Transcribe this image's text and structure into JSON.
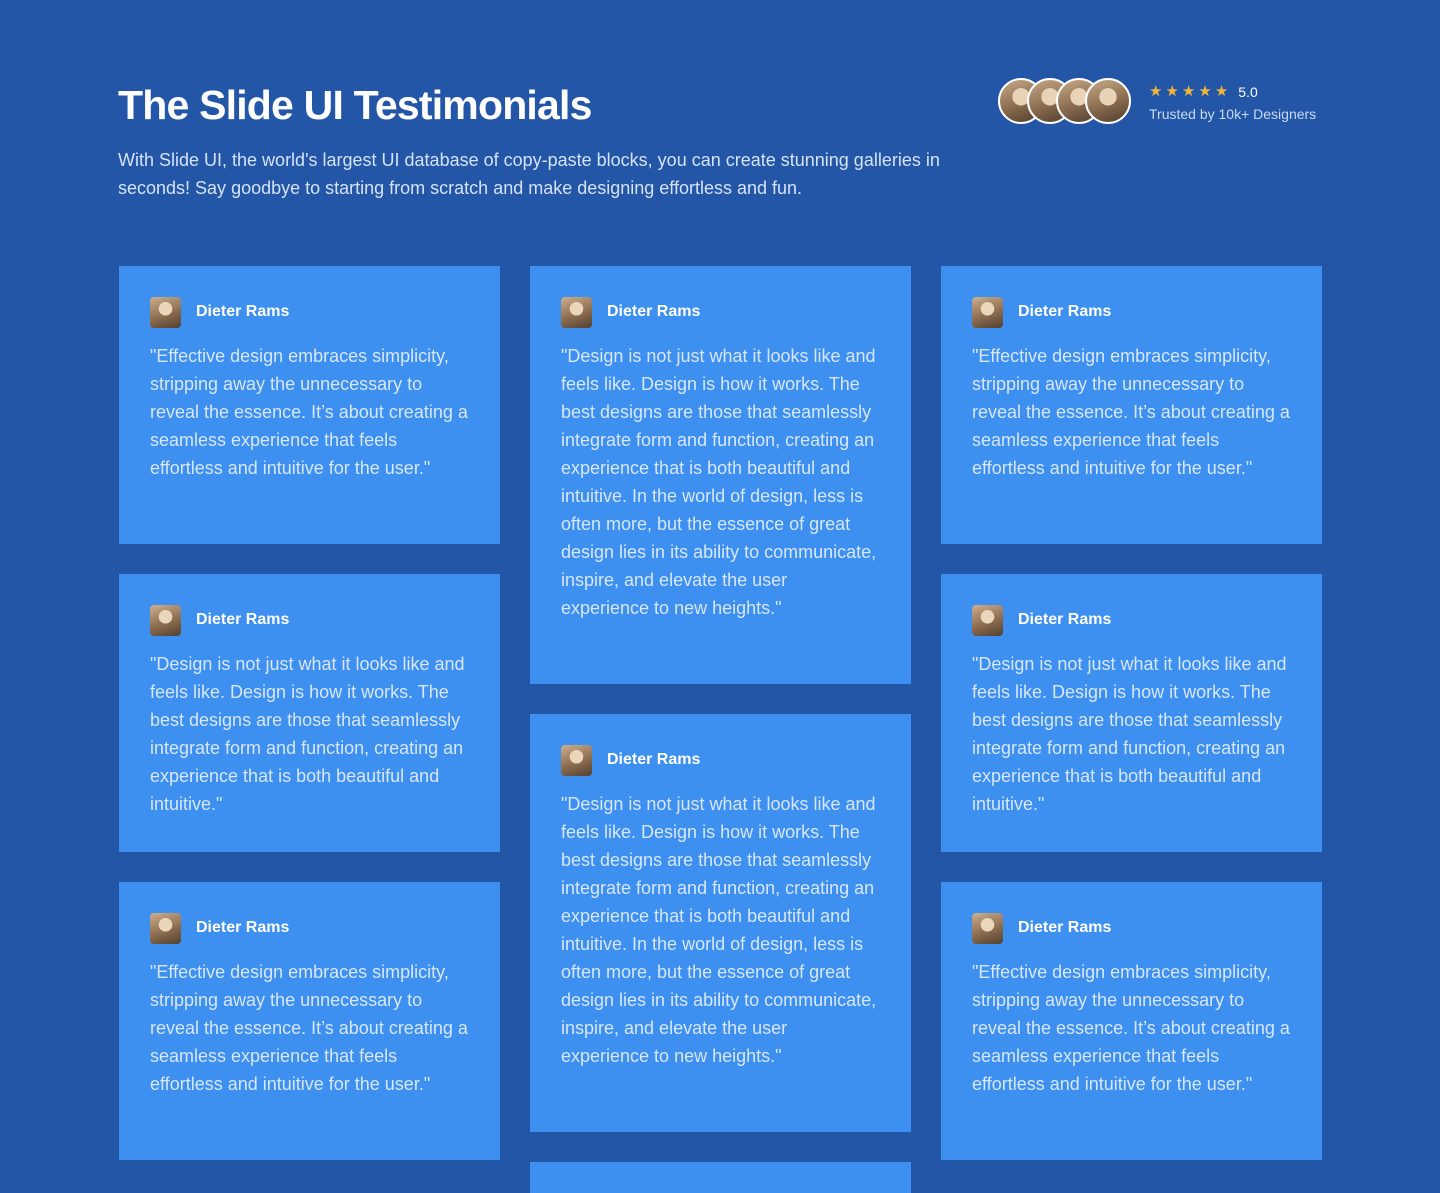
{
  "header": {
    "title": "The Slide UI Testimonials",
    "subtitle": "With Slide UI, the world's largest UI database of copy-paste blocks, you can create stunning galleries in seconds! Say goodbye to starting from scratch and make designing effortless and fun.",
    "rating": {
      "score": "5.0",
      "stars": 5,
      "star_icon": "star-icon",
      "trusted": "Trusted by 10k+ Designers",
      "star_color": "#f5b53a"
    }
  },
  "colors": {
    "background": "#2356a6",
    "card": "#3d8ff0",
    "text": "#ffffff",
    "quote_text": "#d7e7fc"
  },
  "testimonials": [
    {
      "name": "Dieter Rams",
      "quote": "\"Effective design embraces simplicity, stripping away the unnecessary to reveal the essence. It’s about creating a seamless experience that feels effortless and intuitive for the user.\""
    },
    {
      "name": "Dieter Rams",
      "quote": "\"Design is not just what it looks like and feels like. Design is how it works. The best designs are those that seamlessly integrate form and function, creating an experience that is both beautiful and intuitive. In the world of design, less is often more, but the essence of great design lies in its ability to communicate, inspire, and elevate the user experience to new heights.\""
    },
    {
      "name": "Dieter Rams",
      "quote": "\"Effective design embraces simplicity, stripping away the unnecessary to reveal the essence. It’s about creating a seamless experience that feels effortless and intuitive for the user.\""
    },
    {
      "name": "Dieter Rams",
      "quote": "\"Design is not just what it looks like and feels like. Design is how it works. The best designs are those that seamlessly integrate form and function, creating an experience that is both beautiful and intuitive.\""
    },
    {
      "name": "Dieter Rams",
      "quote": "\"Design is not just what it looks like and feels like. Design is how it works. The best designs are those that seamlessly integrate form and function, creating an experience that is both beautiful and intuitive. In the world of design, less is often more, but the essence of great design lies in its ability to communicate, inspire, and elevate the user experience to new heights.\""
    },
    {
      "name": "Dieter Rams",
      "quote": "\"Design is not just what it looks like and feels like. Design is how it works. The best designs are those that seamlessly integrate form and function, creating an experience that is both beautiful and intuitive.\""
    },
    {
      "name": "Dieter Rams",
      "quote": "\"Effective design embraces simplicity, stripping away the unnecessary to reveal the essence. It’s about creating a seamless experience that feels effortless and intuitive for the user.\""
    },
    {
      "name": "Dieter Rams",
      "quote": "\"Effective design embraces simplicity, stripping away the unnecessary to reveal the essence. It’s about creating a seamless experience that feels effortless and intuitive for the user.\""
    }
  ]
}
